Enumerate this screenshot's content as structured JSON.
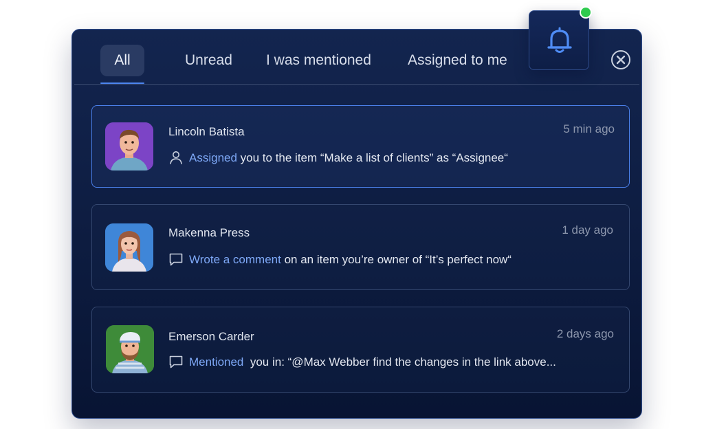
{
  "tabs": [
    {
      "label": "All",
      "active": true
    },
    {
      "label": "Unread"
    },
    {
      "label": "I was mentioned"
    },
    {
      "label": "Assigned to me"
    }
  ],
  "icons": {
    "bell": "bell-icon",
    "close": "close-circle-icon",
    "assign": "user-icon",
    "comment": "comment-icon"
  },
  "colors": {
    "accent": "#7ea8f6",
    "online_dot": "#2ecb4e",
    "panel_bg": "#0d1c40"
  },
  "notifications": [
    {
      "name": "Lincoln Batista",
      "time": "5 min ago",
      "action": "Assigned",
      "text": " you to the item “Make a list of clients” as “Assignee“"
    },
    {
      "name": "Makenna Press",
      "time": "1 day ago",
      "action": "Wrote a comment",
      "text": " on an item you’re owner of “It’s perfect now“"
    },
    {
      "name": "Emerson Carder",
      "time": "2 days ago",
      "action": "Mentioned",
      "text": "  you in: “@Max Webber find the changes in the link above..."
    }
  ]
}
